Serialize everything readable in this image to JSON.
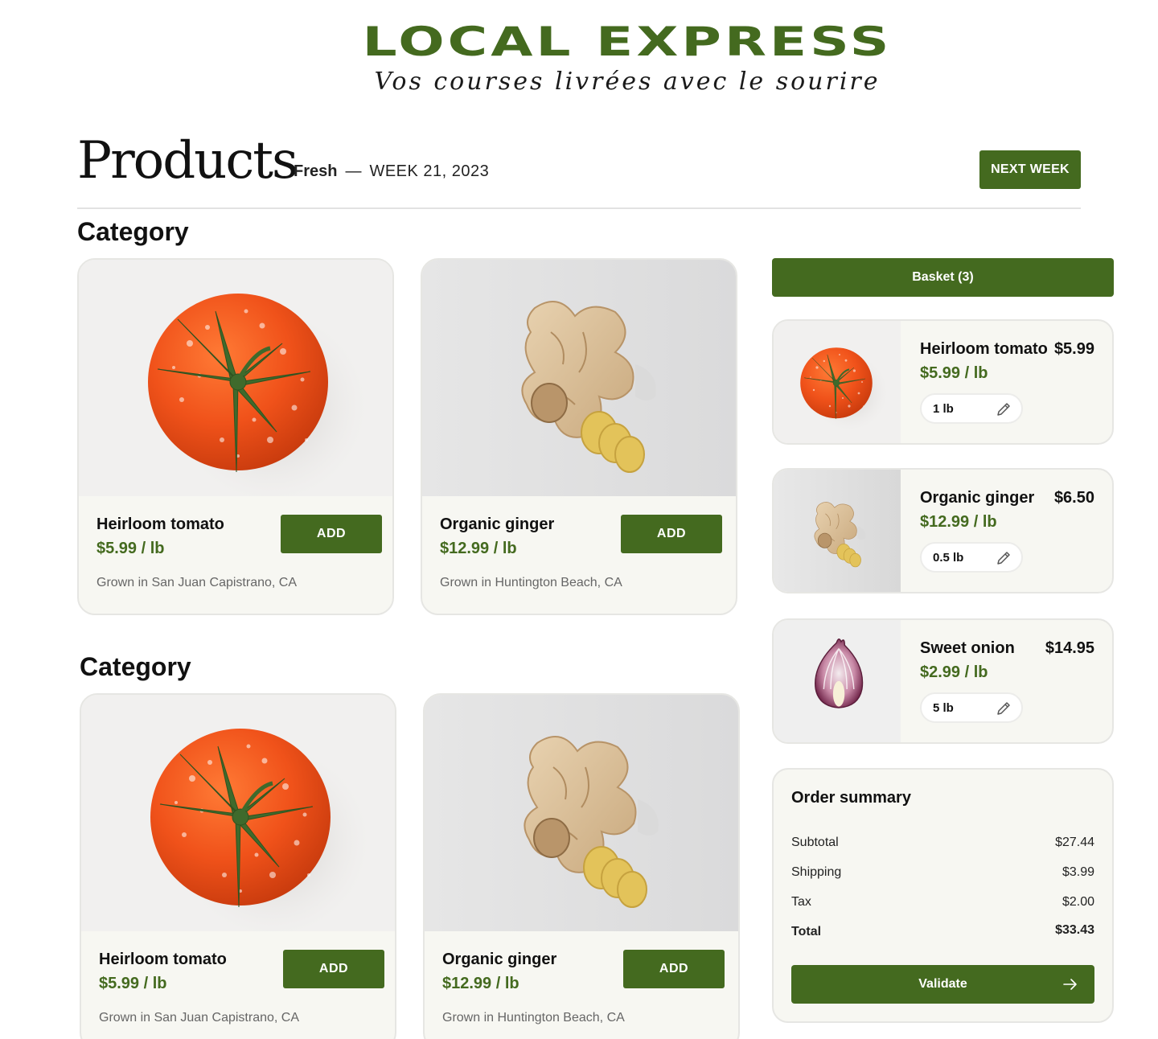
{
  "brand": {
    "name": "LOCAL EXPRESS",
    "tagline": "Vos courses livrées avec le sourire",
    "accent_color": "#446a1f"
  },
  "header": {
    "title": "Products",
    "fresh_label": "Fresh",
    "separator": "—",
    "week_label": "WEEK 21, 2023",
    "next_week_label": "NEXT WEEK"
  },
  "sections": [
    {
      "title": "Category",
      "products": [
        {
          "name": "Heirloom tomato",
          "price": "$5.99 / lb",
          "origin": "Grown in San Juan Capistrano, CA",
          "add_label": "ADD",
          "image": "tomato-image"
        },
        {
          "name": "Organic ginger",
          "price": "$12.99 / lb",
          "origin": "Grown in Huntington Beach, CA",
          "add_label": "ADD",
          "image": "ginger-image"
        }
      ]
    },
    {
      "title": "Category",
      "products": [
        {
          "name": "Heirloom tomato",
          "price": "$5.99 / lb",
          "origin": "Grown in San Juan Capistrano, CA",
          "add_label": "ADD",
          "image": "tomato-image"
        },
        {
          "name": "Organic ginger",
          "price": "$12.99 / lb",
          "origin": "Grown in Huntington Beach, CA",
          "add_label": "ADD",
          "image": "ginger-image"
        }
      ]
    }
  ],
  "basket": {
    "label": "Basket (3)",
    "items": [
      {
        "name": "Heirloom tomato",
        "total": "$5.99",
        "price": "$5.99 / lb",
        "quantity": "1 lb",
        "image": "tomato-image",
        "edit_icon": "pencil-icon"
      },
      {
        "name": "Organic ginger",
        "total": "$6.50",
        "price": "$12.99 / lb",
        "quantity": "0.5 lb",
        "image": "ginger-image",
        "edit_icon": "pencil-icon"
      },
      {
        "name": "Sweet onion",
        "total": "$14.95",
        "price": "$2.99 / lb",
        "quantity": "5 lb",
        "image": "onion-image",
        "edit_icon": "pencil-icon"
      }
    ]
  },
  "order_summary": {
    "title": "Order summary",
    "rows": [
      {
        "label": "Subtotal",
        "value": "$27.44"
      },
      {
        "label": "Shipping",
        "value": "$3.99"
      },
      {
        "label": "Tax",
        "value": "$2.00"
      },
      {
        "label": "Total",
        "value": "$33.43"
      }
    ],
    "validate_label": "Validate",
    "validate_icon": "arrow-right-icon"
  }
}
